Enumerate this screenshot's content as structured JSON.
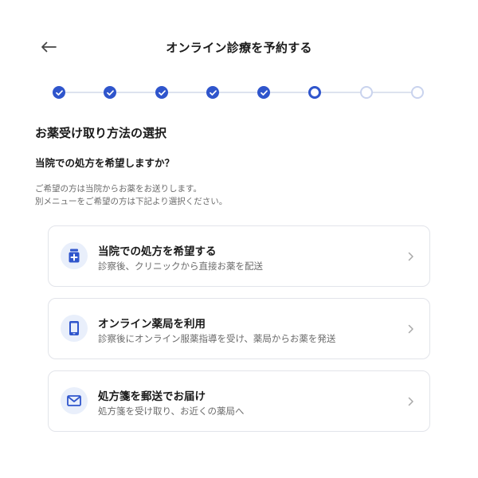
{
  "header": {
    "title": "オンライン診療を予約する",
    "back_icon": "arrow-left-icon"
  },
  "stepper": {
    "total_steps": 8,
    "current_step": 6,
    "colors": {
      "done": "#2f55cc",
      "pending": "#c9d3ee",
      "line": "#dde3ef"
    }
  },
  "section": {
    "title": "お薬受け取り方法の選択",
    "question": "当院での処方を希望しますか？",
    "note_line1": "ご希望の方は当院からお薬をお送りします。",
    "note_line2": "別メニューをご希望の方は下記より選択ください。"
  },
  "options": [
    {
      "title": "当院での処方を希望する",
      "description": "診察後、クリニックから直接お薬を配送",
      "icon": "medicine-box-icon"
    },
    {
      "title": "オンライン薬局を利用",
      "description": "診察後にオンライン服薬指導を受け、薬局からお薬を発送",
      "icon": "smartphone-icon"
    },
    {
      "title": "処方箋を郵送でお届け",
      "description": "処方箋を受け取り、お近くの薬局へ",
      "icon": "mail-icon"
    }
  ],
  "colors": {
    "accent": "#2f55cc",
    "icon_bg": "#e9effb",
    "muted_text": "#6b6b6b",
    "card_border": "#e2e4ea"
  }
}
